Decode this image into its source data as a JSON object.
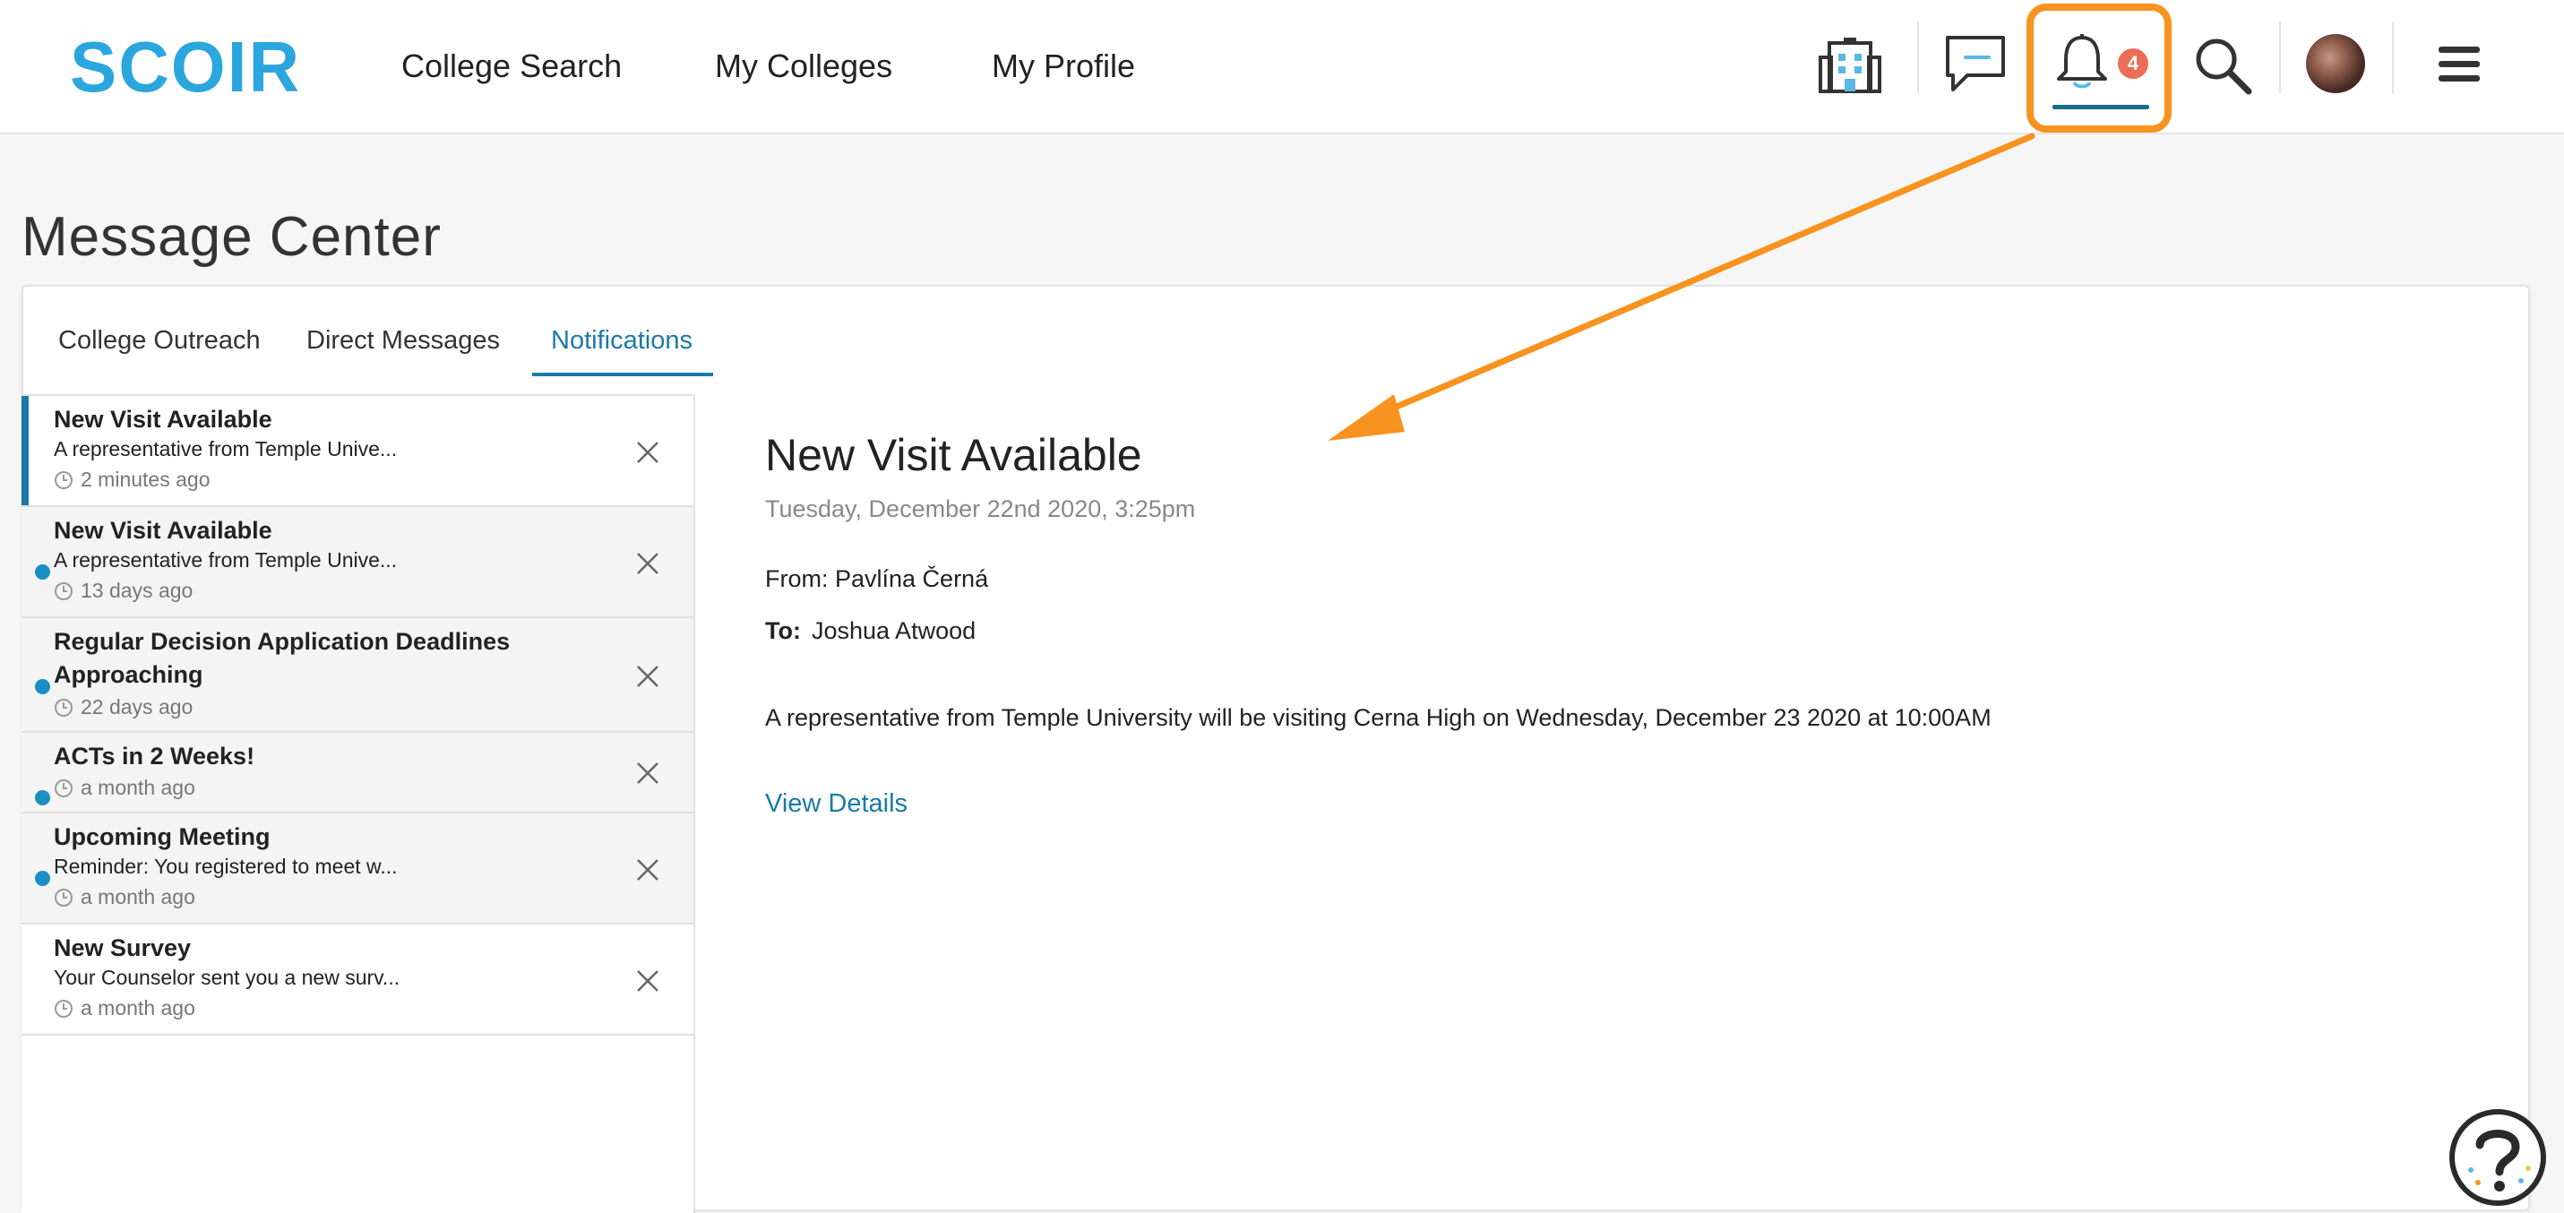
{
  "brand": {
    "logo_text": "SCOIR",
    "color": "#2ba6de"
  },
  "nav": {
    "college_search": "College Search",
    "my_colleges": "My Colleges",
    "my_profile": "My Profile"
  },
  "header_icons": {
    "building": "building-icon",
    "messages": "chat-icon",
    "notifications": "bell-icon",
    "notification_count": "4",
    "search": "search-icon",
    "avatar": "avatar",
    "menu": "hamburger-menu-icon"
  },
  "page": {
    "title": "Message Center"
  },
  "tabs": [
    {
      "label": "College Outreach"
    },
    {
      "label": "Direct Messages"
    },
    {
      "label": "Notifications",
      "active": true
    }
  ],
  "notifications": [
    {
      "title": "New Visit Available",
      "preview": "A representative from Temple Unive...",
      "time": "2 minutes ago",
      "unread": false,
      "active": true
    },
    {
      "title": "New Visit Available",
      "preview": "A representative from Temple Unive...",
      "time": "13 days ago",
      "unread": true
    },
    {
      "title": "Regular Decision Application Deadlines Approaching",
      "preview": "",
      "time": "22 days ago",
      "unread": true
    },
    {
      "title": "ACTs in 2 Weeks!",
      "preview": "",
      "time": "a month ago",
      "unread": true
    },
    {
      "title": "Upcoming Meeting",
      "preview": "Reminder: You registered to meet w...",
      "time": "a month ago",
      "unread": true
    },
    {
      "title": "New Survey",
      "preview": "Your Counselor sent you a new surv...",
      "time": "a month ago",
      "unread": false
    }
  ],
  "detail": {
    "title": "New Visit Available",
    "date": "Tuesday, December 22nd 2020, 3:25pm",
    "from": "From: Pavlína Černá",
    "to_label": "To:",
    "to_value": "Joshua Atwood",
    "body": "A representative from Temple University will be visiting Cerna High on Wednesday, December 23 2020 at 10:00AM",
    "link": "View Details"
  },
  "colors": {
    "accent": "#1a7aa6",
    "unread_dot": "#1a8fc4",
    "badge": "#ec6d55",
    "annotation": "#f7931e"
  }
}
